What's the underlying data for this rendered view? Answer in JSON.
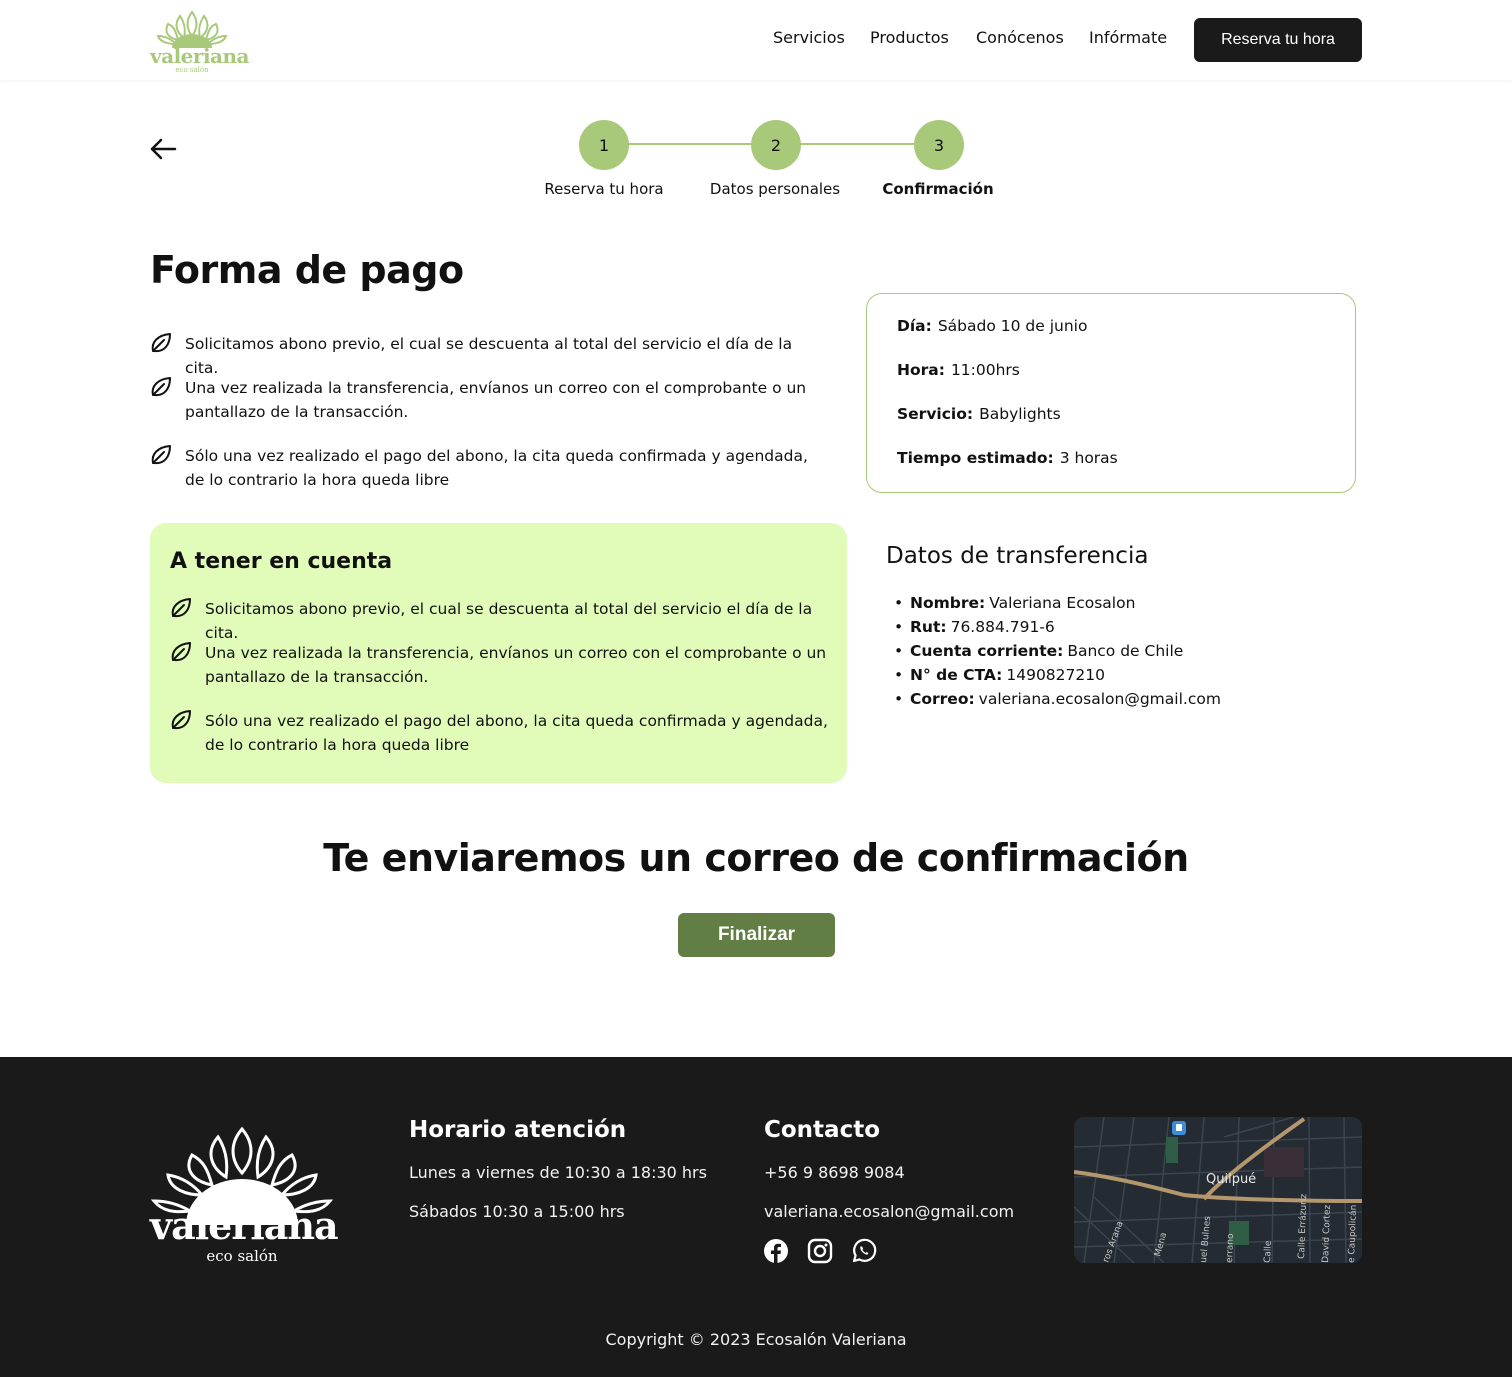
{
  "brand": {
    "name": "valeriana",
    "sub": "eco salón",
    "color": "#a8c97a"
  },
  "nav": {
    "items": [
      "Servicios",
      "Productos",
      "Conócenos",
      "Infórmate"
    ],
    "cta": "Reserva tu hora"
  },
  "stepper": {
    "steps": [
      {
        "number": "1",
        "label": "Reserva tu hora"
      },
      {
        "number": "2",
        "label": "Datos personales"
      },
      {
        "number": "3",
        "label": "Confirmación"
      }
    ]
  },
  "payment": {
    "title": "Forma de pago",
    "bullets": [
      "Solicitamos abono previo, el cual se descuenta al total del servicio el día de la cita.",
      "Una vez realizada la transferencia, envíanos un correo con el comprobante o un pantallazo de la transacción.",
      "Sólo una vez realizado el pago del abono, la cita queda confirmada y agendada, de lo  contrario la hora queda libre"
    ]
  },
  "summary": {
    "day_label": "Día:",
    "day_value": "Sábado 10 de junio",
    "hour_label": "Hora:",
    "hour_value": "11:00hrs",
    "service_label": "Servicio:",
    "service_value": "Babylights",
    "time_label": "Tiempo estimado:",
    "time_value": "3 horas"
  },
  "note": {
    "title": "A tener en cuenta",
    "bullets": [
      "Solicitamos abono previo, el cual se descuenta al total del servicio el día de la cita.",
      "Una vez realizada la transferencia, envíanos un correo con el comprobante o un pantallazo de la transacción.",
      "Sólo una vez realizado el pago del abono, la cita queda confirmada y agendada, de lo  contrario la hora queda libre"
    ],
    "bg_color": "#e1fcb9"
  },
  "transfer": {
    "title": "Datos de transferencia",
    "rows": [
      {
        "label": "Nombre:",
        "value": "Valeriana Ecosalon"
      },
      {
        "label": "Rut:",
        "value": "76.884.791-6"
      },
      {
        "label": "Cuenta corriente:",
        "value": "Banco de Chile"
      },
      {
        "label": "N°  de CTA:",
        "value": "1490827210"
      },
      {
        "label": "Correo:",
        "value": "valeriana.ecosalon@gmail.com"
      }
    ]
  },
  "confirm": {
    "title": "Te enviaremos un correo de confirmación",
    "button": "Finalizar",
    "button_color": "#637e44"
  },
  "footer": {
    "hours_title": "Horario atención",
    "hours_weekdays": "Lunes a viernes de 10:30 a 18:30 hrs",
    "hours_saturday": "Sábados 10:30 a 15:00 hrs",
    "contact_title": "Contacto",
    "phone": "+56 9 8698 9084",
    "email": "valeriana.ecosalon@gmail.com",
    "social_icons": [
      "facebook-icon",
      "instagram-icon",
      "whatsapp-icon"
    ],
    "map_label": "Quilpué",
    "map_streets": [
      "ros Arana",
      "Mena",
      "uel Bulnes",
      "errano",
      "Calle",
      "Calle Errázuriz",
      "David Cortez",
      "e Caupolicán"
    ],
    "copyright": "Copyright © 2023 Ecosalón Valeriana",
    "bg_color": "#1a1a1a"
  }
}
